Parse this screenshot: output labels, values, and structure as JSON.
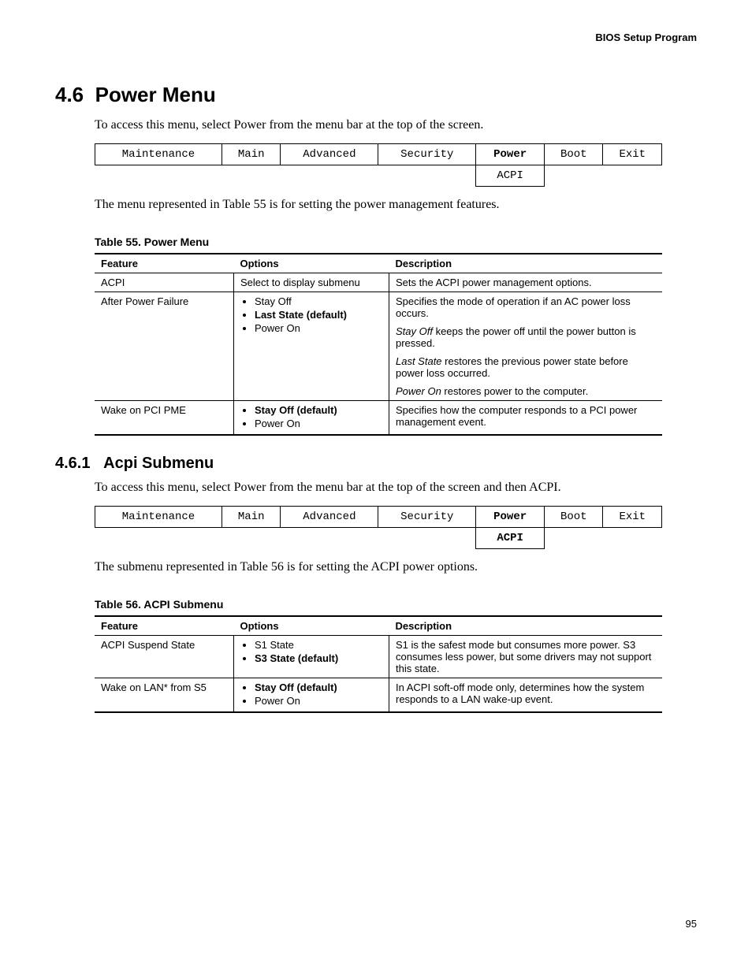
{
  "header": "BIOS Setup Program",
  "page_number": "95",
  "section": {
    "number": "4.6",
    "title": "Power Menu",
    "intro": "To access this menu, select Power from the menu bar at the top of the screen.",
    "desc": "The menu represented in Table 55 is for setting the power management features."
  },
  "menubar1": {
    "row1": [
      "Maintenance",
      "Main",
      "Advanced",
      "Security",
      "Power",
      "Boot",
      "Exit"
    ],
    "bold_index": 4,
    "row2_index": 4,
    "row2_label": "ACPI",
    "row2_bold": false
  },
  "table55": {
    "caption": "Table 55.    Power Menu",
    "headers": [
      "Feature",
      "Options",
      "Description"
    ],
    "rows": [
      {
        "feature": "ACPI",
        "options_text": "Select to display submenu",
        "desc_plain": "Sets the ACPI power management options."
      },
      {
        "feature": "After Power Failure",
        "options_list": [
          {
            "text": "Stay Off",
            "bold": false
          },
          {
            "text": "Last State (default)",
            "bold": true
          },
          {
            "text": "Power On",
            "bold": false
          }
        ],
        "desc_parts": [
          {
            "prefix": "",
            "italic": "",
            "text": "Specifies the mode of operation if an AC power loss occurs."
          },
          {
            "italic": "Stay Off",
            "text": " keeps the power off until the power button is pressed."
          },
          {
            "italic": "Last State",
            "text": " restores the previous power state before power loss occurred."
          },
          {
            "italic": "Power On",
            "text": " restores power to the computer."
          }
        ]
      },
      {
        "feature": "Wake on PCI PME",
        "options_list": [
          {
            "text": "Stay Off (default)",
            "bold": true
          },
          {
            "text": "Power On",
            "bold": false
          }
        ],
        "desc_plain": "Specifies how the computer responds to a PCI power management event."
      }
    ]
  },
  "subsection": {
    "number": "4.6.1",
    "title": "Acpi Submenu",
    "intro": "To access this menu, select Power from the menu bar at the top of the screen and then ACPI.",
    "desc": "The submenu represented in Table 56 is for setting the ACPI power options."
  },
  "menubar2": {
    "row1": [
      "Maintenance",
      "Main",
      "Advanced",
      "Security",
      "Power",
      "Boot",
      "Exit"
    ],
    "bold_index": 4,
    "row2_index": 4,
    "row2_label": "ACPI",
    "row2_bold": true
  },
  "table56": {
    "caption": "Table 56.    ACPI Submenu",
    "headers": [
      "Feature",
      "Options",
      "Description"
    ],
    "rows": [
      {
        "feature": "ACPI Suspend State",
        "options_list": [
          {
            "text": "S1 State",
            "bold": false
          },
          {
            "text": "S3 State (default)",
            "bold": true
          }
        ],
        "desc_plain": "S1 is the safest mode but consumes more power. S3 consumes less power, but some drivers may not support this state."
      },
      {
        "feature": "Wake on LAN* from S5",
        "options_list": [
          {
            "text": "Stay Off (default)",
            "bold": true
          },
          {
            "text": "Power On",
            "bold": false
          }
        ],
        "desc_plain": "In ACPI soft-off mode only, determines how the system responds to a LAN wake-up event."
      }
    ]
  }
}
